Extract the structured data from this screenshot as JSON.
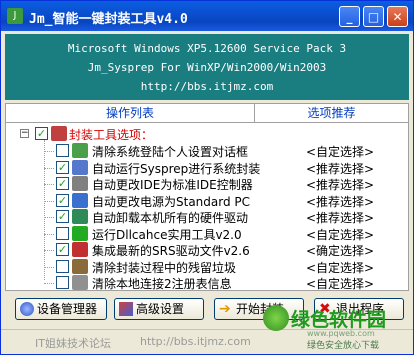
{
  "window": {
    "title": "Jm_智能一键封装工具v4.0",
    "app_icon": "app-icon",
    "minimize": "_",
    "maximize": "□",
    "close": "✕"
  },
  "banner": {
    "line1": "Microsoft Windows XP5.12600  Service Pack 3",
    "line2": "Jm_Sysprep For WinXP/Win2000/Win2003",
    "line3": "http://bbs.itjmz.com"
  },
  "tabs": {
    "left": "操作列表",
    "right": "选项推荐"
  },
  "tree": {
    "root": {
      "label": "封装工具选项：",
      "expander": "−",
      "checked": true
    },
    "items": [
      {
        "label": "清除系统登陆个人设置对话框",
        "tag": "<自定选择>",
        "checked": false,
        "icon": "puzzle-icon",
        "color": "#4aa04a"
      },
      {
        "label": "自动运行Sysprep进行系统封装",
        "tag": "<推荐选择>",
        "checked": true,
        "icon": "cog-window-icon",
        "color": "#5577cc"
      },
      {
        "label": "自动更改IDE为标准IDE控制器",
        "tag": "<推荐选择>",
        "checked": true,
        "icon": "printer-icon",
        "color": "#808080"
      },
      {
        "label": "自动更改电源为Standard PC",
        "tag": "<推荐选择>",
        "checked": true,
        "icon": "monitor-icon",
        "color": "#3a6fd0"
      },
      {
        "label": "自动卸载本机所有的硬件驱动",
        "tag": "<推荐选择>",
        "checked": true,
        "icon": "hardware-icon",
        "color": "#2e8b57"
      },
      {
        "label": "运行Dllcahce实用工具v2.0",
        "tag": "<自定选择>",
        "checked": false,
        "icon": "check-icon",
        "color": "#22aa22"
      },
      {
        "label": "集成最新的SRS驱动文件v2.6",
        "tag": "<确定选择>",
        "checked": true,
        "icon": "chip-icon",
        "color": "#c03030"
      },
      {
        "label": "清除封装过程中的残留垃圾",
        "tag": "<自定选择>",
        "checked": false,
        "icon": "magnifier-icon",
        "color": "#8a6a3a"
      },
      {
        "label": "清除本地连接2注册表信息",
        "tag": "<自定选择>",
        "checked": false,
        "icon": "document-icon",
        "color": "#909090"
      }
    ]
  },
  "buttons": {
    "device_manager": "设备管理器",
    "advanced": "高级设置",
    "start": "开始封装",
    "exit": "退出程序"
  },
  "status": {
    "forum": "IT姐妹技术论坛",
    "url": "http://bbs.itjmz.com"
  },
  "watermark": {
    "main": "绿色软件园",
    "url": "www.pqweb.com",
    "sub": "绿色安全放心下载"
  },
  "colors": {
    "titlebar": "#0b4fd0",
    "banner": "#1a7d80",
    "tab_text": "#003cc0",
    "root_label": "#d40000",
    "check": "#21a121"
  }
}
